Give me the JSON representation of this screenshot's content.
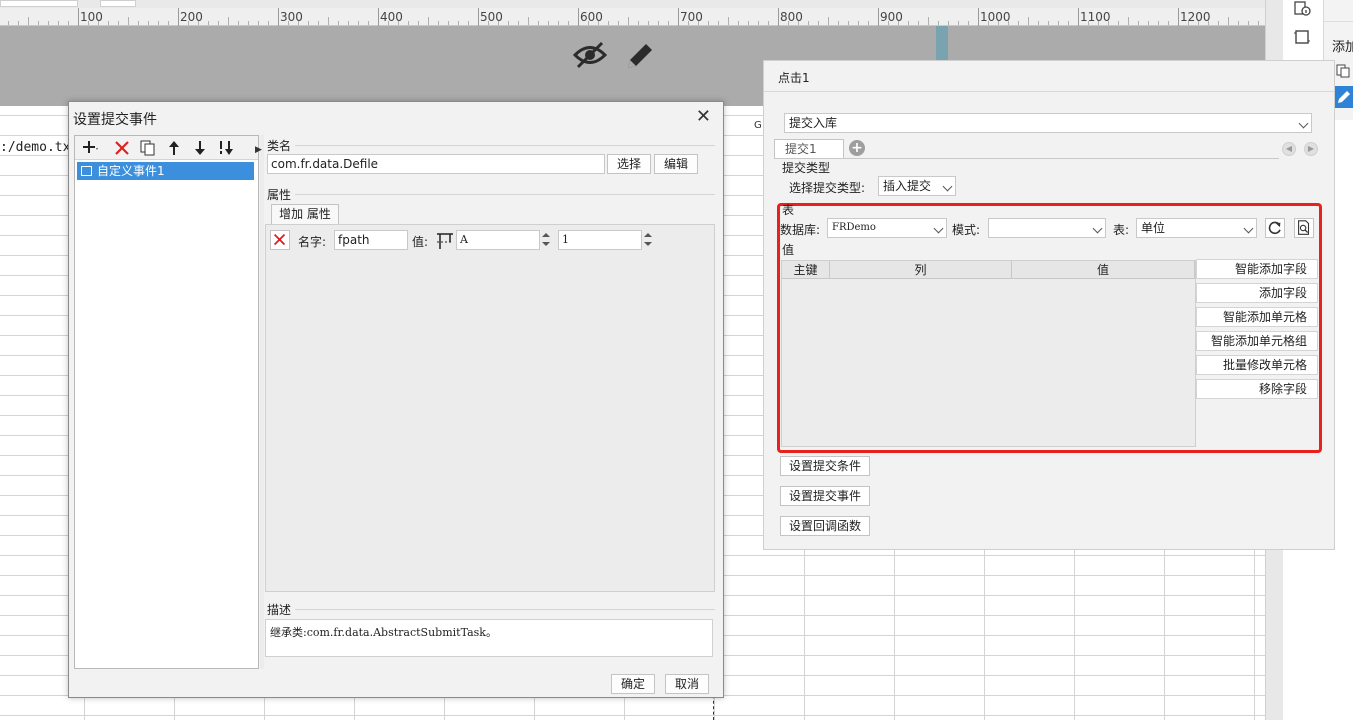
{
  "ruler": {
    "labels": [
      "100",
      "200",
      "300",
      "400",
      "500",
      "600",
      "700",
      "800",
      "900",
      "1000",
      "1100",
      "1200"
    ]
  },
  "sheet": {
    "cell_text": ":/demo.tx",
    "column_marker": "G"
  },
  "right_sidebar": {
    "add_label": "添加"
  },
  "submit_dialog": {
    "title": "设置提交事件",
    "close_glyph": "✕",
    "event_list": {
      "items": [
        {
          "label": "自定义事件1"
        }
      ]
    },
    "class_name": {
      "section_label": "类名",
      "value": "com.fr.data.Defile",
      "select_label": "选择",
      "edit_label": "编辑"
    },
    "properties": {
      "section_label": "属性",
      "add_label": "增加 属性",
      "rows": [
        {
          "name_label": "名字:",
          "name_value": "fpath",
          "value_label": "值:",
          "value_value": "A",
          "second_value": "1"
        }
      ]
    },
    "description": {
      "section_label": "描述",
      "text": "继承类:com.fr.data.AbstractSubmitTask。"
    },
    "ok_label": "确定",
    "cancel_label": "取消"
  },
  "click_panel": {
    "title": "点击1",
    "action_select": "提交入库",
    "tab_label": "提交1",
    "submit_type_section": "提交类型",
    "submit_type_label": "选择提交类型:",
    "submit_type_value": "插入提交",
    "table_section": "表",
    "database_label": "数据库:",
    "database_value": "FRDemo",
    "schema_label": "模式:",
    "schema_value": "",
    "table_label": "表:",
    "table_value": "单位",
    "value_section": "值",
    "columns": [
      "主键",
      "列",
      "值"
    ],
    "field_buttons": [
      "智能添加字段",
      "添加字段",
      "智能添加单元格",
      "智能添加单元格组",
      "批量修改单元格",
      "移除字段"
    ],
    "bottom_buttons": [
      "设置提交条件",
      "设置提交事件",
      "设置回调函数"
    ],
    "highlight_color": "#e8211d"
  }
}
